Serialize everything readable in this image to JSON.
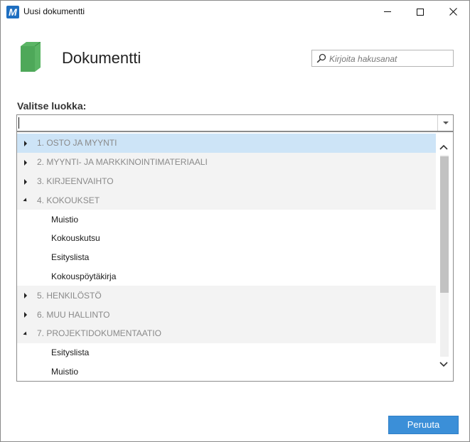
{
  "window": {
    "logo_letter": "M",
    "title": "Uusi dokumentti"
  },
  "header": {
    "heading": "Dokumentti",
    "book_icon_color": "#5bb565"
  },
  "search": {
    "placeholder": "Kirjoita hakusanat",
    "value": ""
  },
  "category": {
    "label": "Valitse luokka:",
    "combo_value": ""
  },
  "tree": {
    "rows": [
      {
        "kind": "cat",
        "expanded": false,
        "selected": true,
        "label": "1. OSTO JA MYYNTI"
      },
      {
        "kind": "cat",
        "expanded": false,
        "selected": false,
        "label": "2. MYYNTI- JA MARKKINOINTIMATERIAALI"
      },
      {
        "kind": "cat",
        "expanded": false,
        "selected": false,
        "label": "3. KIRJEENVAIHTO"
      },
      {
        "kind": "cat",
        "expanded": true,
        "selected": false,
        "label": "4. KOKOUKSET"
      },
      {
        "kind": "item",
        "label": "Muistio"
      },
      {
        "kind": "item",
        "label": "Kokouskutsu"
      },
      {
        "kind": "item",
        "label": "Esityslista"
      },
      {
        "kind": "item",
        "label": "Kokouspöytäkirja"
      },
      {
        "kind": "cat",
        "expanded": false,
        "selected": false,
        "label": "5. HENKILÖSTÖ"
      },
      {
        "kind": "cat",
        "expanded": false,
        "selected": false,
        "label": "6. MUU HALLINTO"
      },
      {
        "kind": "cat",
        "expanded": true,
        "selected": false,
        "label": "7. PROJEKTIDOKUMENTAATIO"
      },
      {
        "kind": "item",
        "label": "Esityslista"
      },
      {
        "kind": "item",
        "label": "Muistio"
      }
    ]
  },
  "footer": {
    "cancel_label": "Peruuta"
  },
  "colors": {
    "accent": "#3b8fd8",
    "selected_row": "#cde4f7",
    "category_row": "#f3f3f3"
  }
}
